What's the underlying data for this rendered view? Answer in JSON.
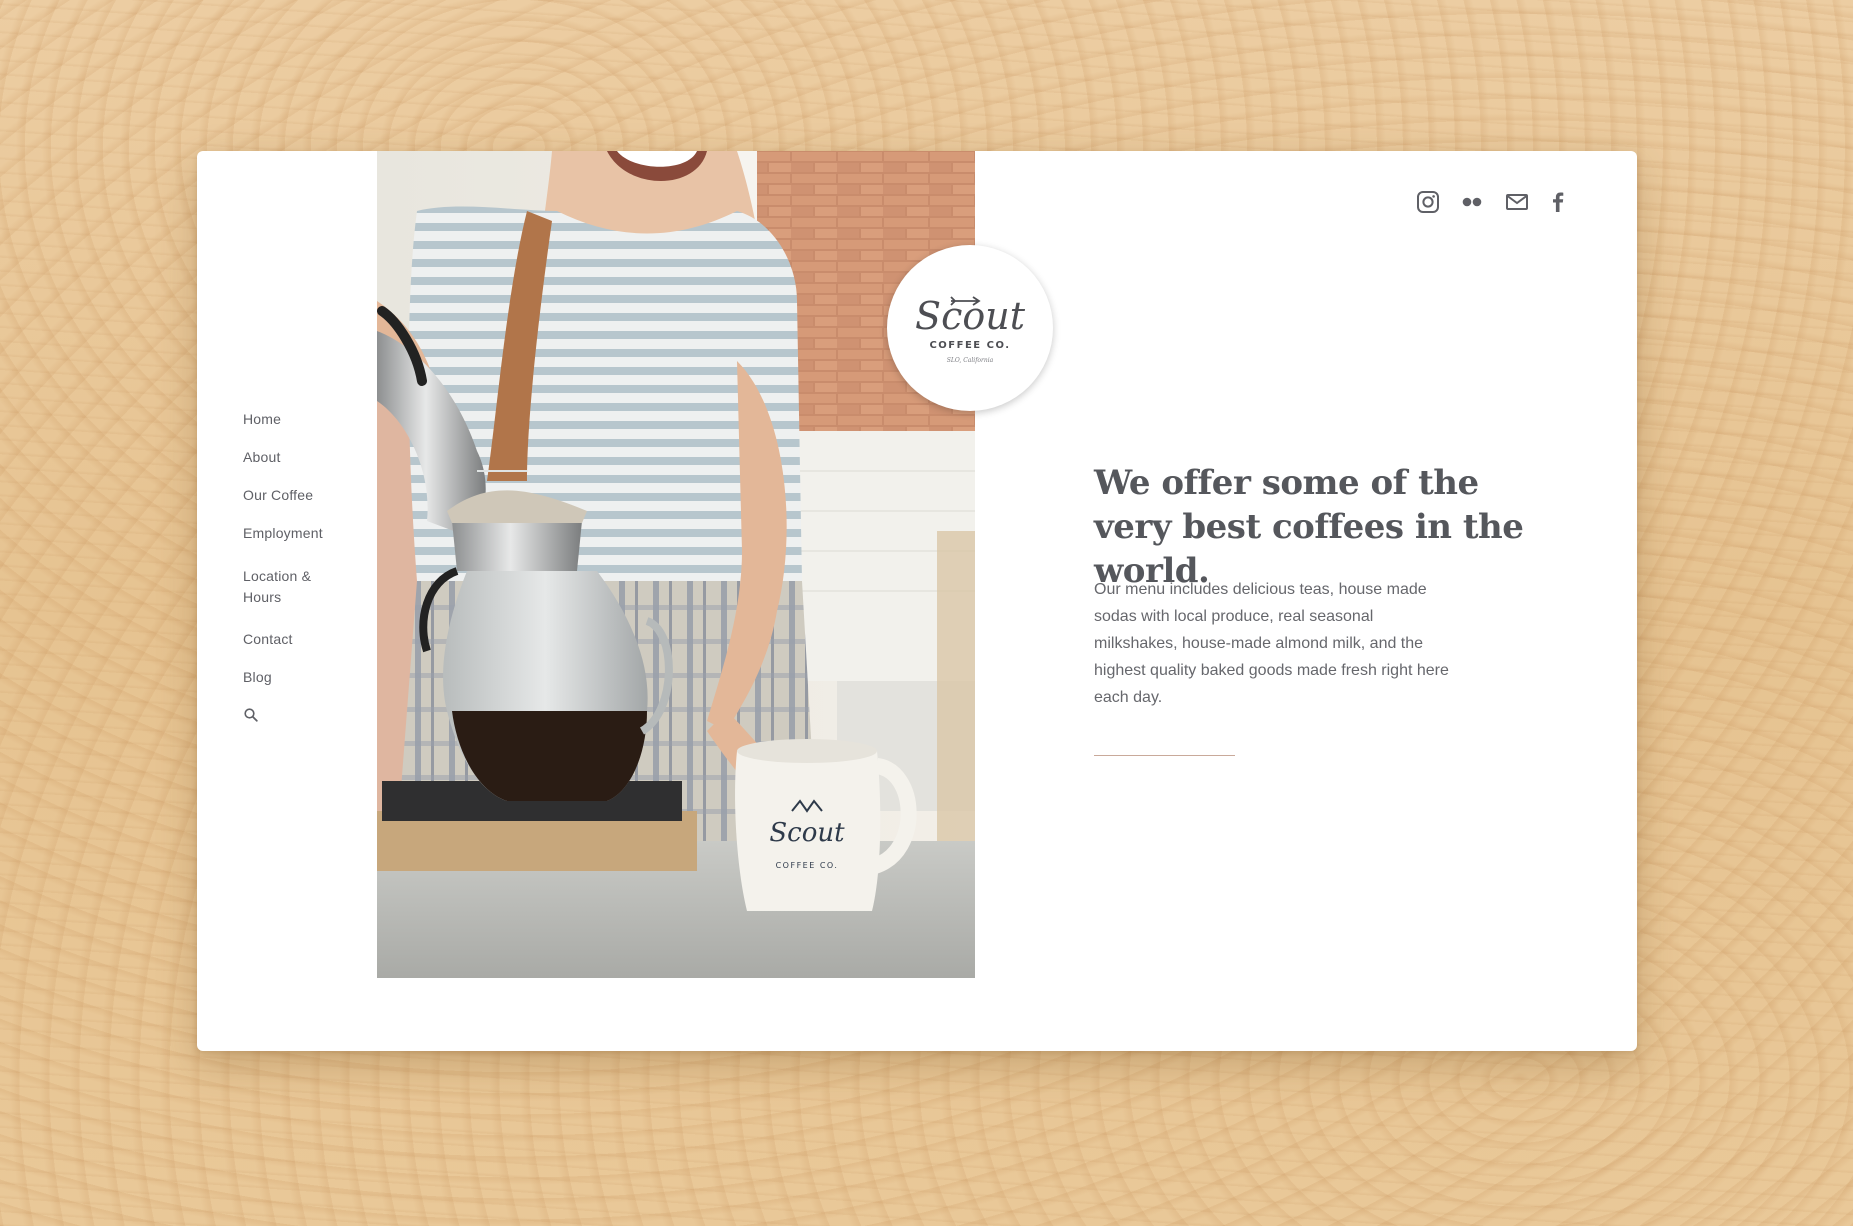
{
  "nav": {
    "items": [
      {
        "label": "Home"
      },
      {
        "label": "About"
      },
      {
        "label": "Our Coffee"
      },
      {
        "label": "Employment"
      },
      {
        "label": "Location & Hours"
      },
      {
        "label": "Contact"
      },
      {
        "label": "Blog"
      }
    ],
    "search_icon": "search-icon"
  },
  "social": {
    "icons": [
      "instagram-icon",
      "flickr-icon",
      "mail-icon",
      "facebook-icon"
    ]
  },
  "logo": {
    "script": "Scout",
    "subtitle": "COFFEE CO.",
    "tagline": "SLO, California"
  },
  "photo": {
    "mug_script": "Scout",
    "mug_subtitle": "COFFEE CO."
  },
  "hero": {
    "headline": "We offer some of the very best coffees in the world.",
    "body": "Our menu includes delicious teas, house made sodas with local produce, real seasonal milkshakes, house-made almond milk, and the highest quality baked goods made fresh right here each day."
  },
  "colors": {
    "text": "#5f6066",
    "headline": "#55575c",
    "divider": "#c9a99a",
    "background_wood": "#e9c99b",
    "card": "#ffffff"
  }
}
